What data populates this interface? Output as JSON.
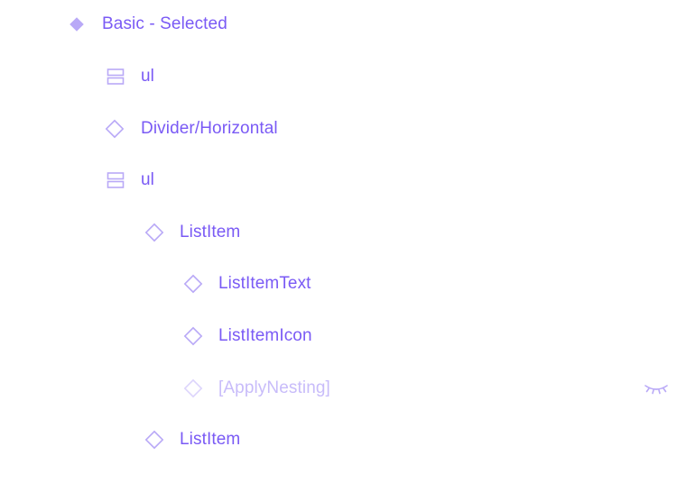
{
  "colors": {
    "accent": "#7a5af5",
    "accent_light": "#c8bcfa",
    "icon_outline": "#b9a9f7"
  },
  "layers": [
    {
      "label": "Basic - Selected",
      "icon": "component-filled-icon",
      "depth": 0,
      "hidden": false
    },
    {
      "label": "ul",
      "icon": "frame-stack-icon",
      "depth": 1,
      "hidden": false
    },
    {
      "label": "Divider/Horizontal",
      "icon": "instance-icon",
      "depth": 1,
      "hidden": false
    },
    {
      "label": "ul",
      "icon": "frame-stack-icon",
      "depth": 1,
      "hidden": false
    },
    {
      "label": "ListItem",
      "icon": "instance-icon",
      "depth": 2,
      "hidden": false
    },
    {
      "label": "ListItemText",
      "icon": "instance-icon",
      "depth": 3,
      "hidden": false
    },
    {
      "label": "ListItemIcon",
      "icon": "instance-icon",
      "depth": 3,
      "hidden": false
    },
    {
      "label": "[ApplyNesting]",
      "icon": "instance-icon",
      "depth": 3,
      "hidden": true,
      "visibility_icon": "eye-closed-icon"
    },
    {
      "label": "ListItem",
      "icon": "instance-icon",
      "depth": 2,
      "hidden": false
    }
  ]
}
